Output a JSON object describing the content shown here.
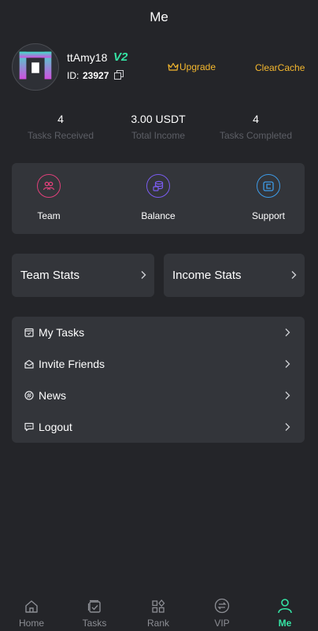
{
  "header": {
    "title": "Me"
  },
  "profile": {
    "username": "ttAmy18",
    "vip_level": "V2",
    "id_label": "ID:",
    "id_value": "23927",
    "upgrade_label": "Upgrade",
    "clearcache_label": "ClearCache"
  },
  "stats": [
    {
      "value": "4",
      "label": "Tasks Received"
    },
    {
      "value": "3.00 USDT",
      "label": "Total Income"
    },
    {
      "value": "4",
      "label": "Tasks Completed"
    }
  ],
  "quick_actions": [
    {
      "label": "Team",
      "icon": "team-icon",
      "color": "#e0407a"
    },
    {
      "label": "Balance",
      "icon": "balance-icon",
      "color": "#7a5cf0"
    },
    {
      "label": "Support",
      "icon": "support-icon",
      "color": "#3d9be8"
    }
  ],
  "cards": [
    {
      "label": "Team Stats"
    },
    {
      "label": "Income Stats"
    }
  ],
  "menu": [
    {
      "label": "My Tasks",
      "icon": "tasks-icon"
    },
    {
      "label": "Invite Friends",
      "icon": "invite-icon"
    },
    {
      "label": "News",
      "icon": "news-icon"
    },
    {
      "label": "Logout",
      "icon": "logout-icon"
    }
  ],
  "tabs": [
    {
      "label": "Home",
      "icon": "home-icon"
    },
    {
      "label": "Tasks",
      "icon": "tasks-tab-icon"
    },
    {
      "label": "Rank",
      "icon": "rank-icon"
    },
    {
      "label": "VIP",
      "icon": "vip-icon"
    },
    {
      "label": "Me",
      "icon": "user-icon",
      "active": true
    }
  ],
  "colors": {
    "background": "#242529",
    "panel": "#33353a",
    "accent_green": "#35e3a4",
    "accent_gold": "#f5b82e"
  }
}
